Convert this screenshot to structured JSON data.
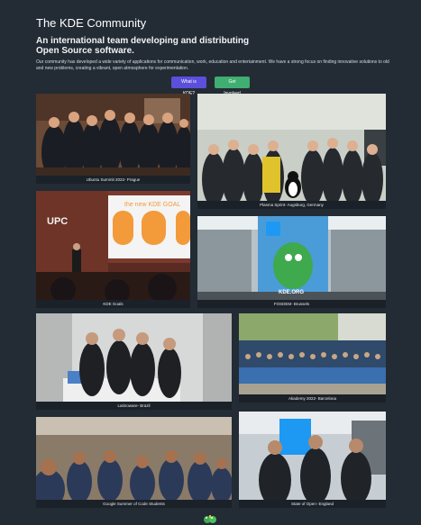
{
  "hero": {
    "title": "The KDE Community",
    "subtitle": "An international team developing and distributing Open Source software.",
    "description": "Our community has developed a wide variety of applications for communication, work, education and entertainment. We have a strong focus on finding innovative solutions to old and new problems, creating a vibrant, open atmosphere for experimentation.",
    "buttons": {
      "primary": "What is KDE?",
      "secondary": "Get Involved"
    }
  },
  "gallery": [
    {
      "caption": "Ubuntu Summit 2022- Prague"
    },
    {
      "caption": "Plasma Sprint- Augsburg, Germany"
    },
    {
      "caption": "KDE Goals",
      "slide_title": "the new KDE GOAL",
      "sign": "UPC"
    },
    {
      "caption": "FOSDEM- Brussels",
      "banner_text": "KDE.ORG"
    },
    {
      "caption": "Latinoware- Brazil"
    },
    {
      "caption": "Akademy 2022- Barcelona"
    },
    {
      "caption": "Google Summer of Code Students"
    },
    {
      "caption": "State of Open- England"
    }
  ],
  "colors": {
    "background": "#232b34",
    "primary_button": "#5b4fdc",
    "success_button": "#3fae70",
    "kde_blue": "#1d99f3"
  },
  "footer": {
    "icon": "konqi-dragon-icon"
  }
}
